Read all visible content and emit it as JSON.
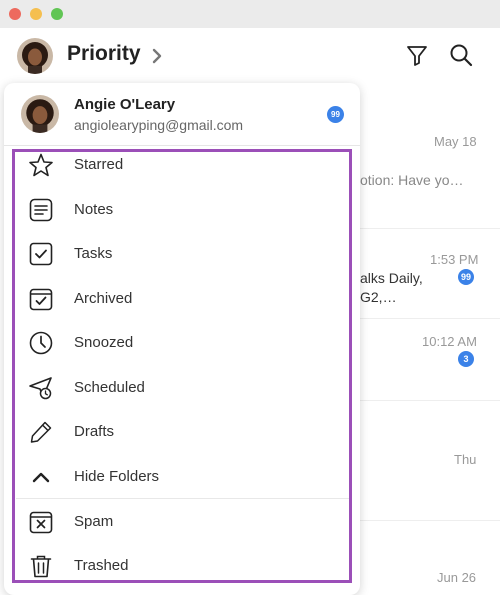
{
  "header": {
    "title": "Priority"
  },
  "account": {
    "name": "Angie O'Leary",
    "email": "angiolearyping@gmail.com",
    "badge": "99"
  },
  "menu": [
    {
      "label": "Starred",
      "icon": "star-icon"
    },
    {
      "label": "Notes",
      "icon": "notes-icon"
    },
    {
      "label": "Tasks",
      "icon": "tasks-icon"
    },
    {
      "label": "Archived",
      "icon": "archive-icon"
    },
    {
      "label": "Snoozed",
      "icon": "clock-icon"
    },
    {
      "label": "Scheduled",
      "icon": "send-clock-icon"
    },
    {
      "label": "Drafts",
      "icon": "pencil-icon"
    },
    {
      "label": "Hide Folders",
      "icon": "chevron-up-icon"
    },
    {
      "label": "Spam",
      "icon": "spam-icon"
    },
    {
      "label": "Trashed",
      "icon": "trash-icon"
    }
  ],
  "background_list": {
    "row1_date": "May 18",
    "row1_snippet": "otion: Have yo…",
    "row2_time": "1:53 PM",
    "row2_line1": "alks Daily,",
    "row2_line2": "G2,…",
    "row2_badge": "99",
    "row3_time": "10:12 AM",
    "row3_badge": "3",
    "row4_date": "Thu",
    "row5_date": "Jun 26"
  },
  "colors": {
    "accent": "#3b82e8",
    "highlight": "#9b4fb8"
  }
}
